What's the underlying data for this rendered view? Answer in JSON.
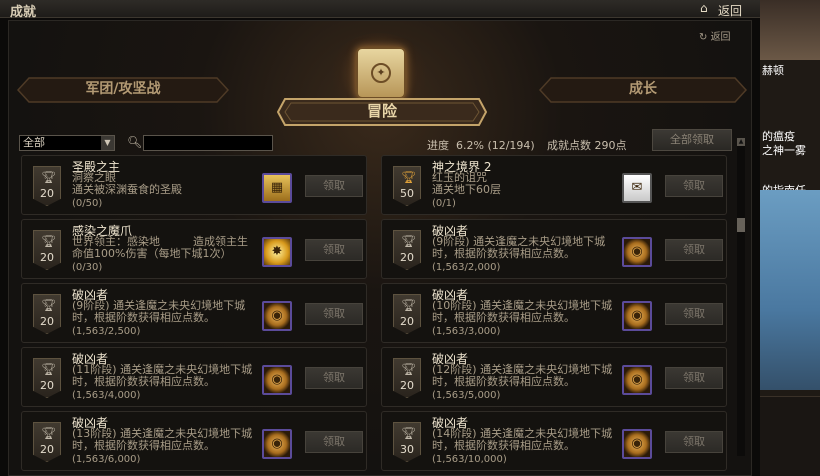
{
  "window": {
    "title": "成就",
    "home_icon": "home-icon",
    "back_label": "返回"
  },
  "header": {
    "back_label": "返回"
  },
  "tabs": {
    "left": "军团/攻坚战",
    "right": "成长",
    "active": "冒险"
  },
  "filter": {
    "selected": "全部",
    "search_placeholder": ""
  },
  "stats": {
    "progress_label": "进度",
    "progress_value": "6.2% (12/194)",
    "points_label": "成就点数",
    "points_value": "290点"
  },
  "claim_all_label": "全部领取",
  "claim_label": "领取",
  "cards": [
    {
      "title": "圣殿之主",
      "desc": "洞察之眼\n通关被深渊蚕食的圣殿",
      "progress": "(0/50)",
      "points": "20",
      "trophy": "silver",
      "icon": "map-icon"
    },
    {
      "title": "神之境界 2",
      "desc": "红玉的诅咒\n通关地下60层",
      "progress": "(0/1)",
      "points": "50",
      "trophy": "gold",
      "icon": "scroll-paper-icon"
    },
    {
      "title": "感染之魔爪",
      "desc": "世界领主：感染地　　　造成领主生命值100%伤害（每地下城1次）",
      "progress": "(0/30)",
      "points": "20",
      "trophy": "silver",
      "icon": "claw-burst-icon"
    },
    {
      "title": "破凶者",
      "desc": "(9阶段) 通关逢魔之未央幻境地下城时，根据阶数获得相应点数。",
      "progress": "(1,563/2,000)",
      "points": "20",
      "trophy": "silver",
      "icon": "coin-emblem-icon"
    },
    {
      "title": "破凶者",
      "desc": "(9阶段) 通关逢魔之未央幻境地下城时，根据阶数获得相应点数。",
      "progress": "(1,563/2,500)",
      "points": "20",
      "trophy": "silver",
      "icon": "coin-emblem-icon"
    },
    {
      "title": "破凶者",
      "desc": "(10阶段) 通关逢魔之未央幻境地下城时，根据阶数获得相应点数。",
      "progress": "(1,563/3,000)",
      "points": "20",
      "trophy": "silver",
      "icon": "coin-emblem-icon"
    },
    {
      "title": "破凶者",
      "desc": "(11阶段) 通关逢魔之未央幻境地下城时，根据阶数获得相应点数。",
      "progress": "(1,563/4,000)",
      "points": "20",
      "trophy": "silver",
      "icon": "coin-emblem-icon"
    },
    {
      "title": "破凶者",
      "desc": "(12阶段) 通关逢魔之未央幻境地下城时，根据阶数获得相应点数。",
      "progress": "(1,563/5,000)",
      "points": "20",
      "trophy": "silver",
      "icon": "coin-emblem-icon"
    },
    {
      "title": "破凶者",
      "desc": "(13阶段) 通关逢魔之未央幻境地下城时，根据阶数获得相应点数。",
      "progress": "(1,563/6,000)",
      "points": "20",
      "trophy": "silver",
      "icon": "coin-emblem-icon"
    },
    {
      "title": "破凶者",
      "desc": "(14阶段) 通关逢魔之未央幻境地下城时，根据阶数获得相应点数。",
      "progress": "(1,563/10,000)",
      "points": "30",
      "trophy": "silver",
      "icon": "coin-emblem-icon"
    }
  ],
  "side": {
    "line1": "赫顿",
    "line2": "的瘟疫",
    "line3": "之神一雾",
    "line4": "的指南任"
  }
}
